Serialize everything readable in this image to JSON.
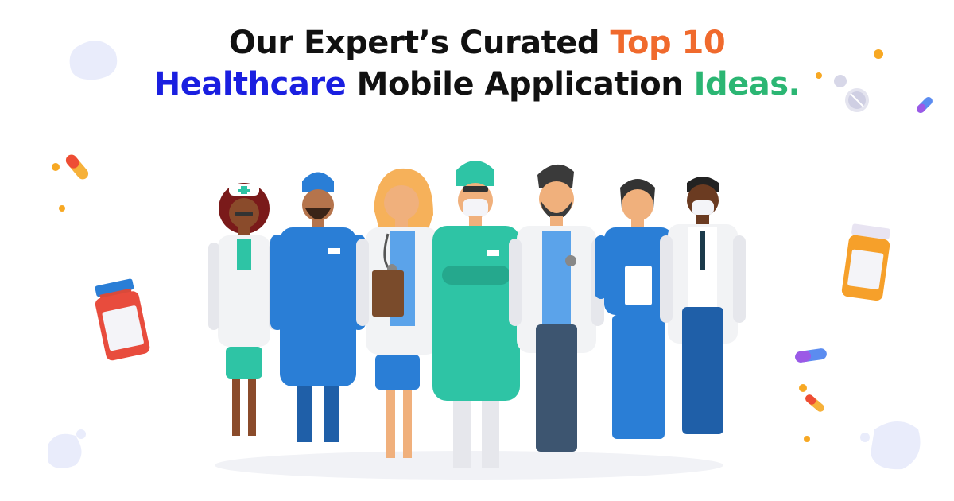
{
  "headline": {
    "line1_prefix": "Our Expert’s Curated",
    "line1_highlight": "Top 10",
    "line2_highlight1": "Healthcare",
    "line2_middle": "Mobile Application",
    "line2_highlight2": "Ideas."
  },
  "colors": {
    "text": "#111111",
    "highlight_orange": "#f06a2d",
    "highlight_blue": "#1a1fe0",
    "highlight_green": "#2bb673",
    "scrubs_blue": "#2a7ed6",
    "scrubs_teal": "#2ec4a5",
    "lab_coat": "#f2f3f5"
  },
  "illustration": {
    "people": [
      "nurse",
      "male-doctor-blue-scrubs",
      "female-doctor-clipboard",
      "surgeon",
      "bearded-doctor",
      "female-doctor-tablet",
      "male-doctor-mask"
    ],
    "decorations": [
      "pill-bottle-red",
      "pill-bottle-orange",
      "capsule",
      "tablet",
      "blob"
    ]
  }
}
